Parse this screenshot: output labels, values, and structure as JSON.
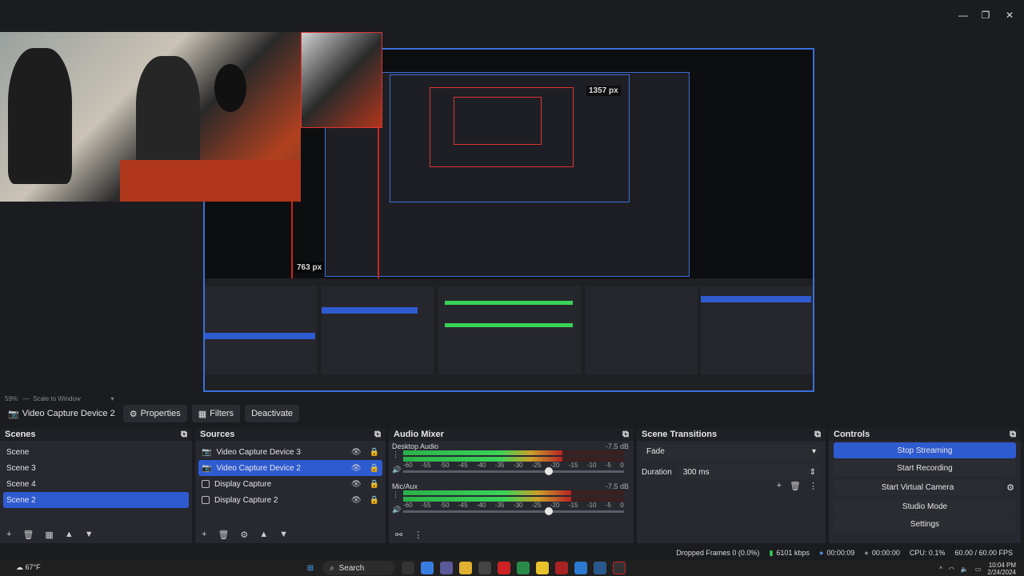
{
  "window": {
    "minimize": "—",
    "maximize": "❐",
    "close": "✕"
  },
  "preview": {
    "width_label": "1357 px",
    "height_label": "763 px",
    "zoom": "59%",
    "scale_mode": "Scale to Window"
  },
  "toolbar": {
    "selected_source": "Video Capture Device 2",
    "properties": "Properties",
    "filters": "Filters",
    "deactivate": "Deactivate"
  },
  "scenes": {
    "title": "Scenes",
    "items": [
      {
        "label": "Scene",
        "selected": false
      },
      {
        "label": "Scene 3",
        "selected": false
      },
      {
        "label": "Scene 4",
        "selected": false
      },
      {
        "label": "Scene 2",
        "selected": true
      }
    ]
  },
  "sources": {
    "title": "Sources",
    "items": [
      {
        "label": "Video Capture Device 3",
        "type": "camera",
        "selected": false
      },
      {
        "label": "Video Capture Device 2",
        "type": "camera",
        "selected": true
      },
      {
        "label": "Display Capture",
        "type": "display",
        "selected": false
      },
      {
        "label": "Display Capture 2",
        "type": "display",
        "selected": false
      }
    ]
  },
  "mixer": {
    "title": "Audio Mixer",
    "channels": [
      {
        "name": "Desktop Audio",
        "db": "-7.5 dB",
        "level": 0.72,
        "volume": 0.66
      },
      {
        "name": "Mic/Aux",
        "db": "-7.5 dB",
        "level": 0.76,
        "volume": 0.66
      }
    ],
    "scale": [
      "-60",
      "-55",
      "-50",
      "-45",
      "-40",
      "-35",
      "-30",
      "-25",
      "-20",
      "-15",
      "-10",
      "-5",
      "0"
    ]
  },
  "transitions": {
    "title": "Scene Transitions",
    "type": "Fade",
    "duration_label": "Duration",
    "duration_value": "300 ms"
  },
  "controls": {
    "title": "Controls",
    "stop_streaming": "Stop Streaming",
    "start_recording": "Start Recording",
    "start_virtual_camera": "Start Virtual Camera",
    "studio_mode": "Studio Mode",
    "settings": "Settings"
  },
  "status": {
    "dropped": "Dropped Frames 0 (0.0%)",
    "bitrate": "6101 kbps",
    "stream_time": "00:00:09",
    "rec_time": "00:00:00",
    "cpu": "CPU: 0.1%",
    "fps": "60.00 / 60.00 FPS"
  },
  "taskbar": {
    "weather": "67°F",
    "search": "Search",
    "time": "10:04 PM",
    "date": "2/24/2024"
  },
  "colors": {
    "accent": "#2f5bd0",
    "background": "#1b1c20",
    "dock": "#272830",
    "meter_green": "#3ad357",
    "meter_yellow": "#c8a12a",
    "meter_red": "#bb2222"
  }
}
